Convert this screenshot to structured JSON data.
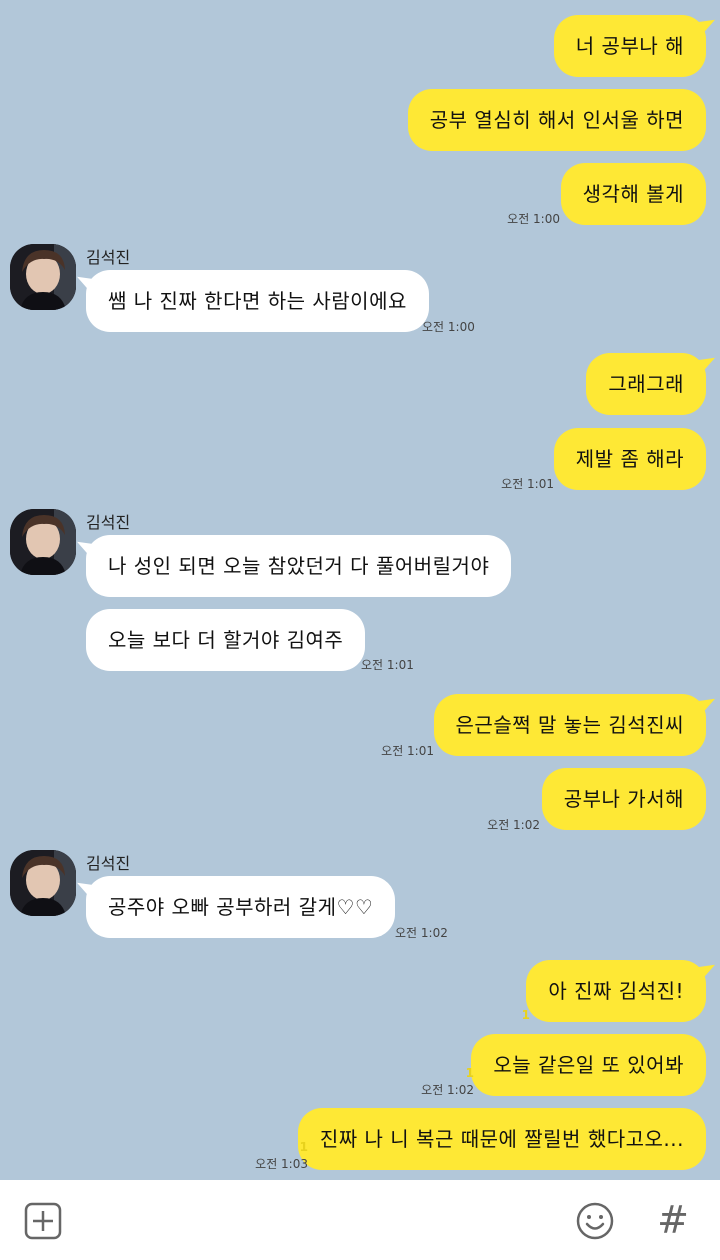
{
  "messages": [
    {
      "text": "너 공부나 해"
    },
    {
      "text": "공부 열심히 해서 인서울 하면"
    },
    {
      "text": "생각해 볼게",
      "time": "오전 1:00"
    },
    {
      "sender": "김석진",
      "text": "쌤 나 진짜 한다면 하는 사람이에요",
      "time": "오전 1:00"
    },
    {
      "text": "그래그래"
    },
    {
      "text": "제발 좀 해라",
      "time": "오전 1:01"
    },
    {
      "sender": "김석진",
      "text": "나 성인 되면 오늘 참았던거 다 풀어버릴거야"
    },
    {
      "text": "오늘 보다 더 할거야 김여주",
      "time": "오전 1:01"
    },
    {
      "text": "은근슬쩍 말 놓는 김석진씨",
      "time": "오전 1:01"
    },
    {
      "text": "공부나 가서해",
      "time": "오전 1:02"
    },
    {
      "sender": "김석진",
      "text": "공주야 오빠 공부하러 갈게♡♡",
      "time": "오전 1:02"
    },
    {
      "text": "아 진짜 김석진!",
      "unread": "1"
    },
    {
      "text": "오늘 같은일 또 있어봐",
      "unread": "1",
      "time": "오전 1:02"
    },
    {
      "text": "진짜 나 니 복근 때문에 짤릴번 했다고오...",
      "unread": "1",
      "time": "오전 1:03"
    }
  ],
  "toolbar": {
    "icons": [
      "plus-box-icon",
      "emoji-icon",
      "hashtag-icon"
    ],
    "hash_label": "#"
  },
  "colors": {
    "background": "#b2c7d9",
    "my_bubble": "#fee835",
    "other_bubble": "#ffffff",
    "unread": "#e8d21d"
  }
}
